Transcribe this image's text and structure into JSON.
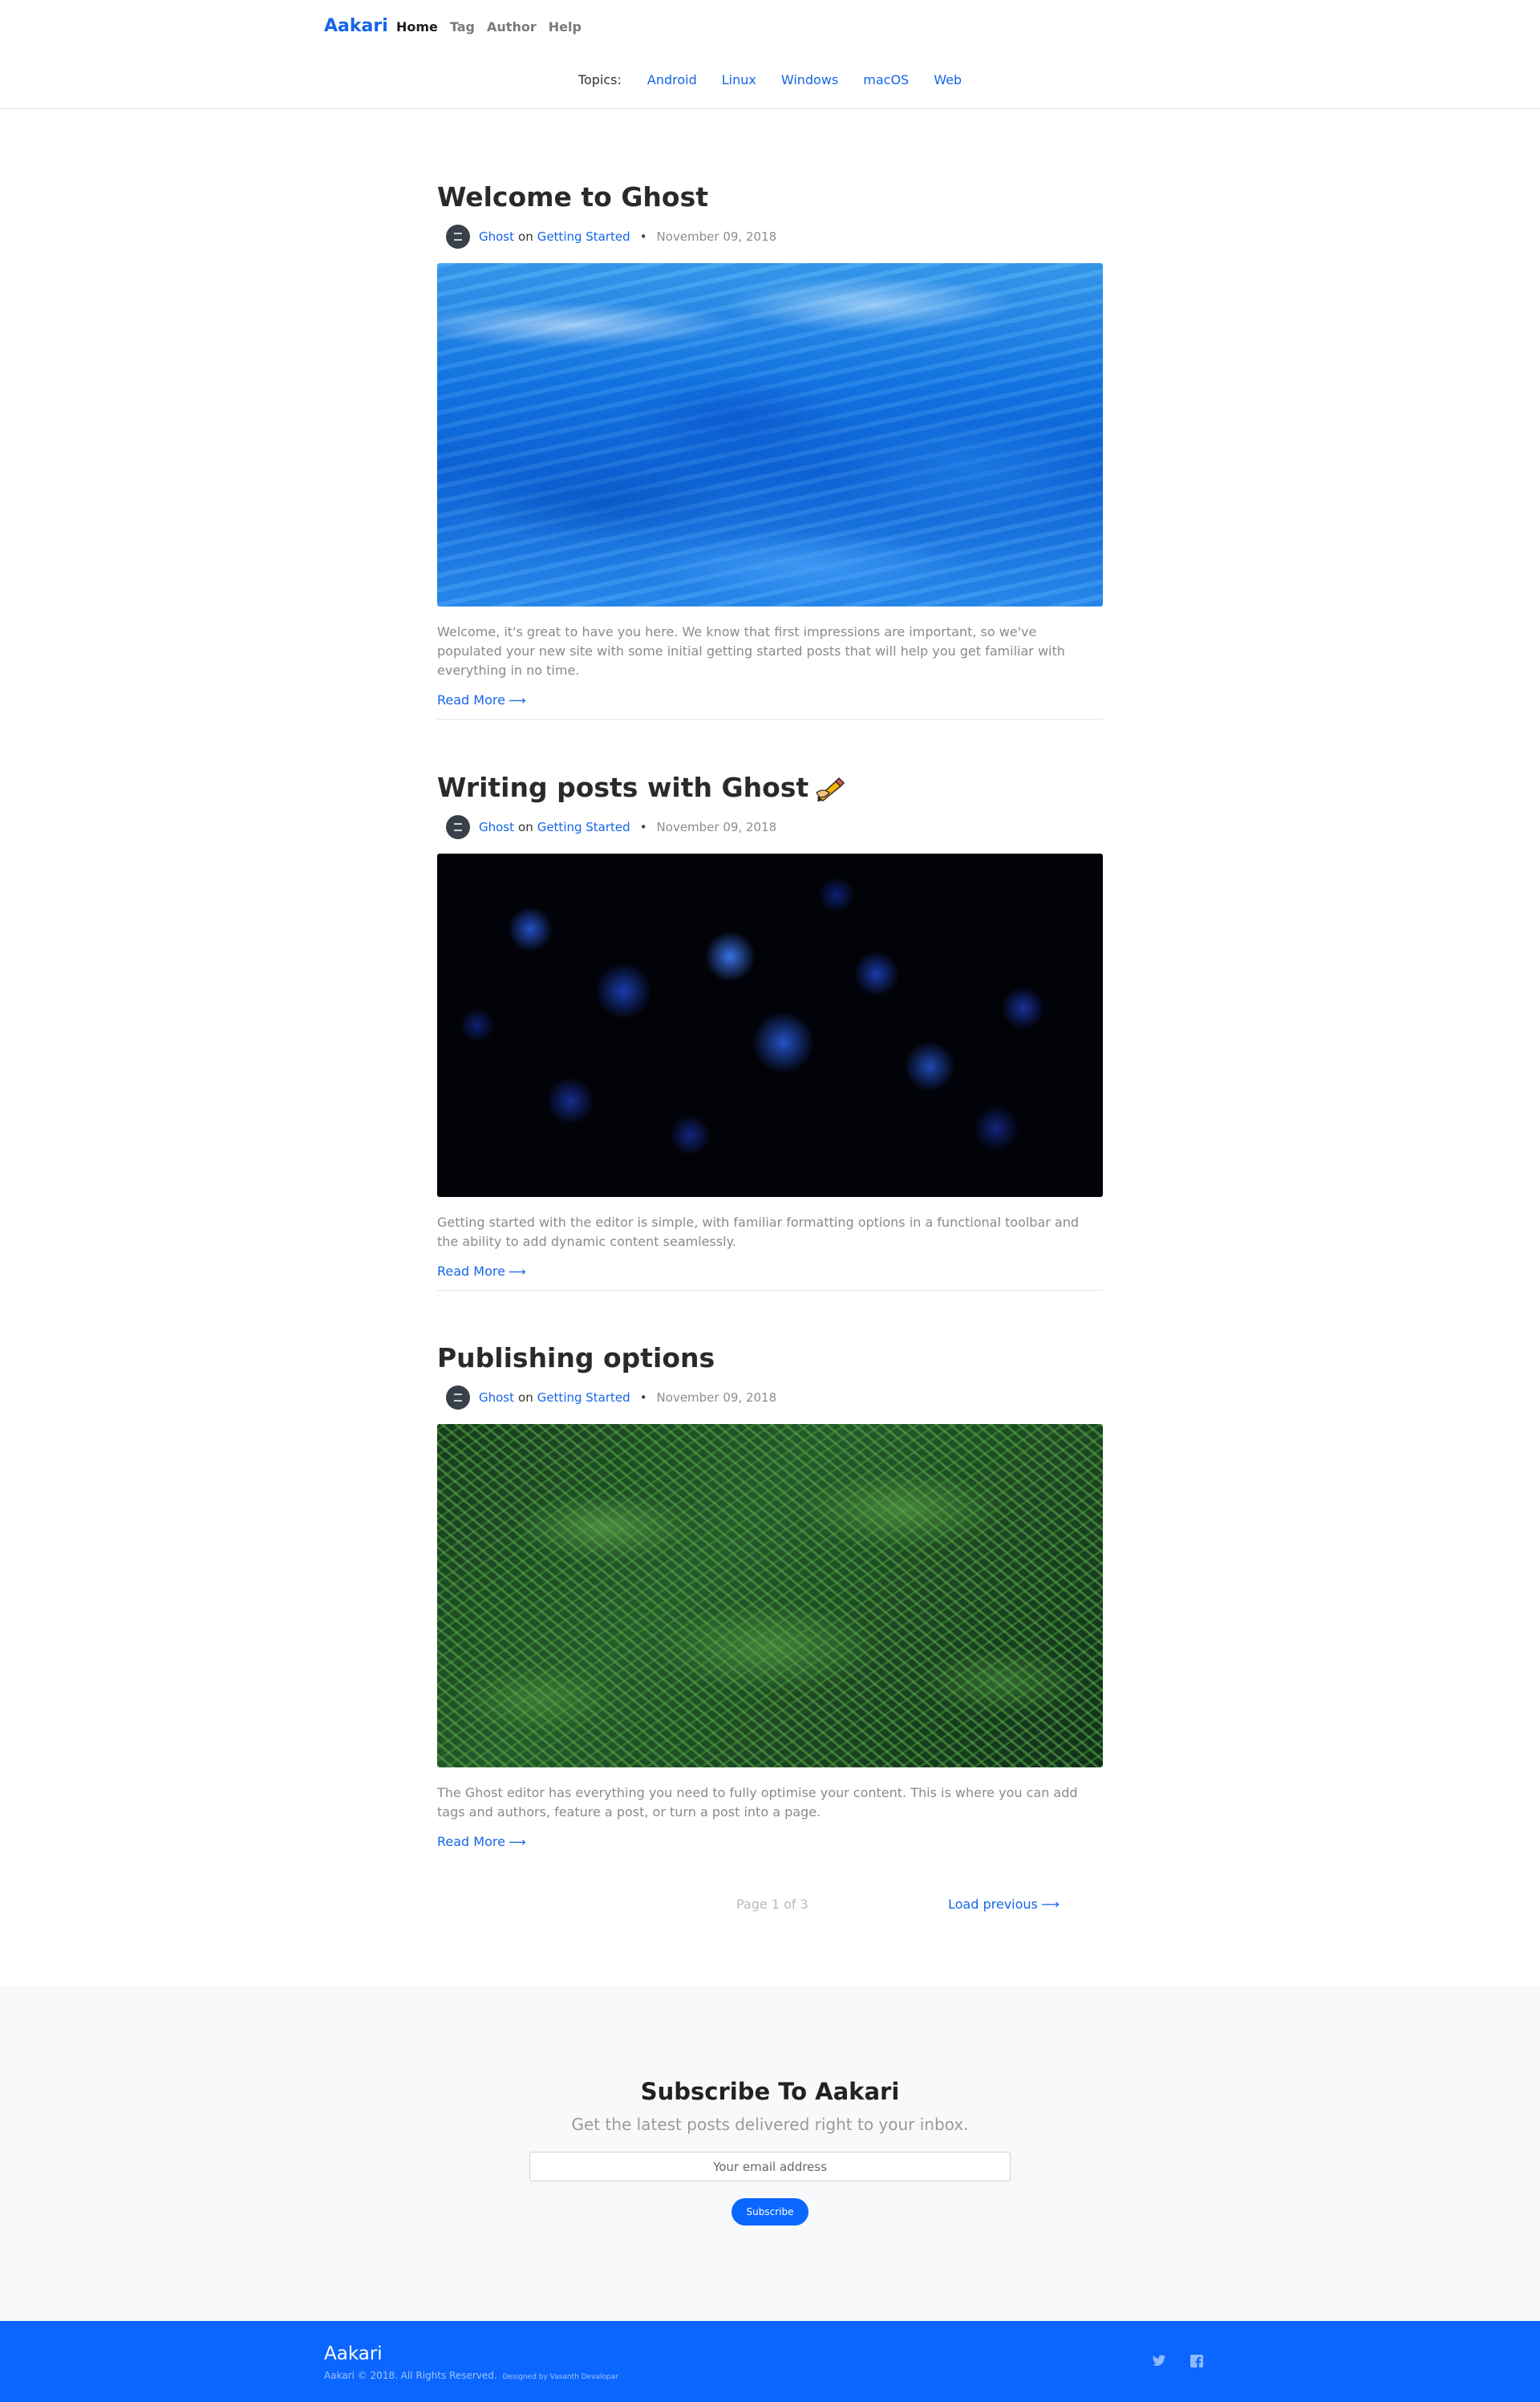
{
  "header": {
    "brand": "Aakari",
    "nav": [
      "Home",
      "Tag",
      "Author",
      "Help"
    ],
    "topics_label": "Topics:",
    "topics": [
      "Android",
      "Linux",
      "Windows",
      "macOS",
      "Web"
    ]
  },
  "posts": [
    {
      "title": "Welcome to Ghost",
      "author": "Ghost",
      "on": "on",
      "tag": "Getting Started",
      "separator": "•",
      "date": "November 09, 2018",
      "excerpt": "Welcome, it's great to have you here. We know that first impressions are important, so we've populated your new site with some initial getting started posts that will help you get familiar with everything in no time.",
      "read_more": "Read More",
      "icon": "arrow-right-icon",
      "image": "blue-water-image"
    },
    {
      "title": "Writing posts with Ghost",
      "title_icon": "writing-hand-icon",
      "author": "Ghost",
      "on": "on",
      "tag": "Getting Started",
      "separator": "•",
      "date": "November 09, 2018",
      "excerpt": "Getting started with the editor is simple, with familiar formatting options in a functional toolbar and the ability to add dynamic content seamlessly.",
      "read_more": "Read More",
      "icon": "arrow-right-icon",
      "image": "blue-leaves-image"
    },
    {
      "title": "Publishing options",
      "author": "Ghost",
      "on": "on",
      "tag": "Getting Started",
      "separator": "•",
      "date": "November 09, 2018",
      "excerpt": "The Ghost editor has everything you need to fully optimise your content. This is where you can add tags and authors, feature a post, or turn a post into a page.",
      "read_more": "Read More",
      "icon": "arrow-right-icon",
      "image": "green-fern-image"
    }
  ],
  "pagination": {
    "page_info": "Page 1 of 3",
    "load_previous": "Load previous"
  },
  "subscribe": {
    "title": "Subscribe To Aakari",
    "description": "Get the latest posts delivered right to your inbox.",
    "placeholder": "Your email address",
    "button": "Subscribe"
  },
  "footer": {
    "brand": "Aakari",
    "copyright": "Aakari © 2018. All Rights Reserved.",
    "designed_by": "Designed by Vasanth Devalopar",
    "social": [
      "twitter-icon",
      "facebook-icon"
    ]
  },
  "colors": {
    "accent": "#1565e8",
    "footer_bg": "#0a66ff",
    "subscribe_bg": "#f8f9fb"
  }
}
